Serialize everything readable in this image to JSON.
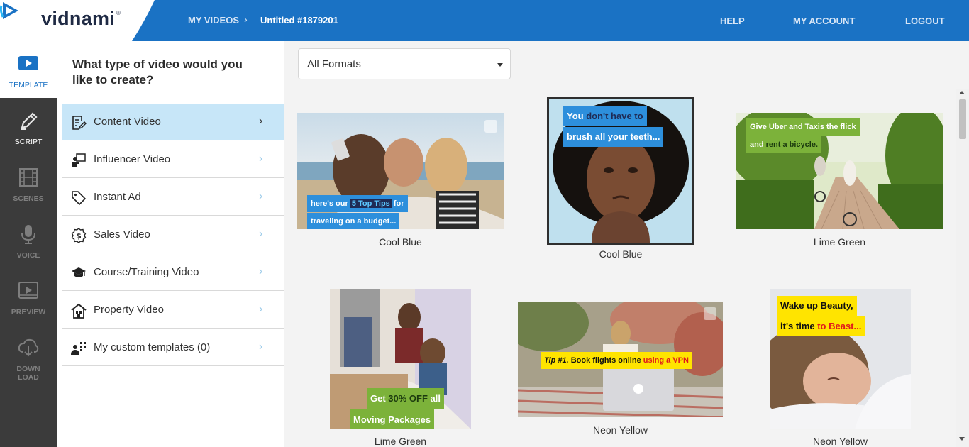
{
  "brand": {
    "name": "vidnami",
    "reg": "®",
    "accent": "#1a72c4"
  },
  "breadcrumb": {
    "parent": "MY VIDEOS",
    "separator": "›",
    "current": "Untitled #1879201"
  },
  "nav": {
    "help": "HELP",
    "account": "MY ACCOUNT",
    "logout": "LOGOUT"
  },
  "rail": [
    {
      "label": "TEMPLATE",
      "icon": "play-screen-icon",
      "active": true
    },
    {
      "label": "SCRIPT",
      "icon": "pencil-icon"
    },
    {
      "label": "SCENES",
      "icon": "film-icon"
    },
    {
      "label": "VOICE",
      "icon": "microphone-icon"
    },
    {
      "label": "PREVIEW",
      "icon": "preview-screen-icon"
    },
    {
      "label_line1": "DOWN",
      "label_line2": "LOAD",
      "icon": "cloud-download-icon"
    }
  ],
  "panel": {
    "title": "What type of video would you like to create?",
    "categories": [
      {
        "label": "Content Video",
        "icon": "document-edit-icon",
        "active": true
      },
      {
        "label": "Influencer Video",
        "icon": "presenter-icon"
      },
      {
        "label": "Instant Ad",
        "icon": "tag-icon"
      },
      {
        "label": "Sales Video",
        "icon": "dollar-badge-icon"
      },
      {
        "label": "Course/Training Video",
        "icon": "graduation-cap-icon"
      },
      {
        "label": "Property Video",
        "icon": "house-icon"
      },
      {
        "label": "My custom templates (0)",
        "icon": "users-grid-icon"
      }
    ],
    "chevron": "›"
  },
  "filter": {
    "selected": "All Formats"
  },
  "templates": [
    {
      "name": "Cool Blue",
      "caption_lines": [
        [
          "here's our ",
          "5 Top Tips",
          " for"
        ],
        [
          "traveling on a budget..."
        ]
      ]
    },
    {
      "name": "Cool Blue",
      "caption_lines": [
        [
          "You ",
          "don't have to"
        ],
        [
          "brush all your teeth..."
        ]
      ]
    },
    {
      "name": "Lime Green",
      "caption_lines": [
        [
          "Give Uber and Taxis the flick"
        ],
        [
          "and ",
          "rent a bicycle."
        ]
      ]
    },
    {
      "name": "Lime Green",
      "caption_lines": [
        [
          "Get ",
          "30% OFF",
          " all"
        ],
        [
          "Moving Packages"
        ]
      ]
    },
    {
      "name": "Neon Yellow",
      "caption_lines": [
        [
          "Tip #1. ",
          "Book flights online ",
          "using a VPN"
        ]
      ]
    },
    {
      "name": "Neon Yellow",
      "caption_lines": [
        [
          "Wake up Beauty,"
        ],
        [
          "it's time ",
          "to Beast..."
        ]
      ]
    }
  ]
}
